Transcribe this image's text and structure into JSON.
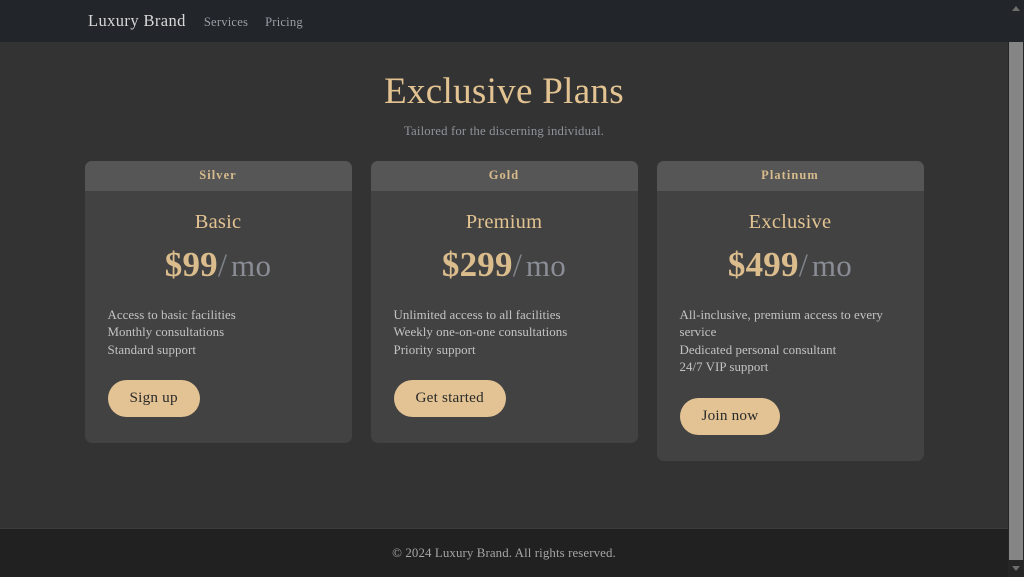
{
  "navbar": {
    "brand": "Luxury Brand",
    "links": [
      {
        "label": "Services"
      },
      {
        "label": "Pricing"
      }
    ]
  },
  "hero": {
    "title": "Exclusive Plans",
    "subtitle": "Tailored for the discerning individual."
  },
  "plans": [
    {
      "tier": "Silver",
      "name": "Basic",
      "amount": "$99",
      "slash": "/",
      "period": "mo",
      "features": [
        "Access to basic facilities",
        "Monthly consultations",
        "Standard support"
      ],
      "cta": "Sign up"
    },
    {
      "tier": "Gold",
      "name": "Premium",
      "amount": "$299",
      "slash": "/",
      "period": "mo",
      "features": [
        "Unlimited access to all facilities",
        "Weekly one-on-one consultations",
        "Priority support"
      ],
      "cta": "Get started"
    },
    {
      "tier": "Platinum",
      "name": "Exclusive",
      "amount": "$499",
      "slash": "/",
      "period": "mo",
      "features": [
        "All-inclusive, premium access to every service",
        "Dedicated personal consultant",
        "24/7 VIP support"
      ],
      "cta": "Join now"
    }
  ],
  "footer": {
    "text": "© 2024 Luxury Brand. All rights reserved."
  },
  "scrollbar": {
    "up_icon": "chevron-up-icon",
    "down_icon": "chevron-down-icon"
  },
  "colors": {
    "page_background": "#333333",
    "navbar_background": "#22252a",
    "card_background": "#424242",
    "card_header_background": "#565656",
    "accent_gold": "#e2c391",
    "price_gold": "#dbbd8d",
    "button_background": "#e3c394",
    "footer_background": "#212121"
  }
}
